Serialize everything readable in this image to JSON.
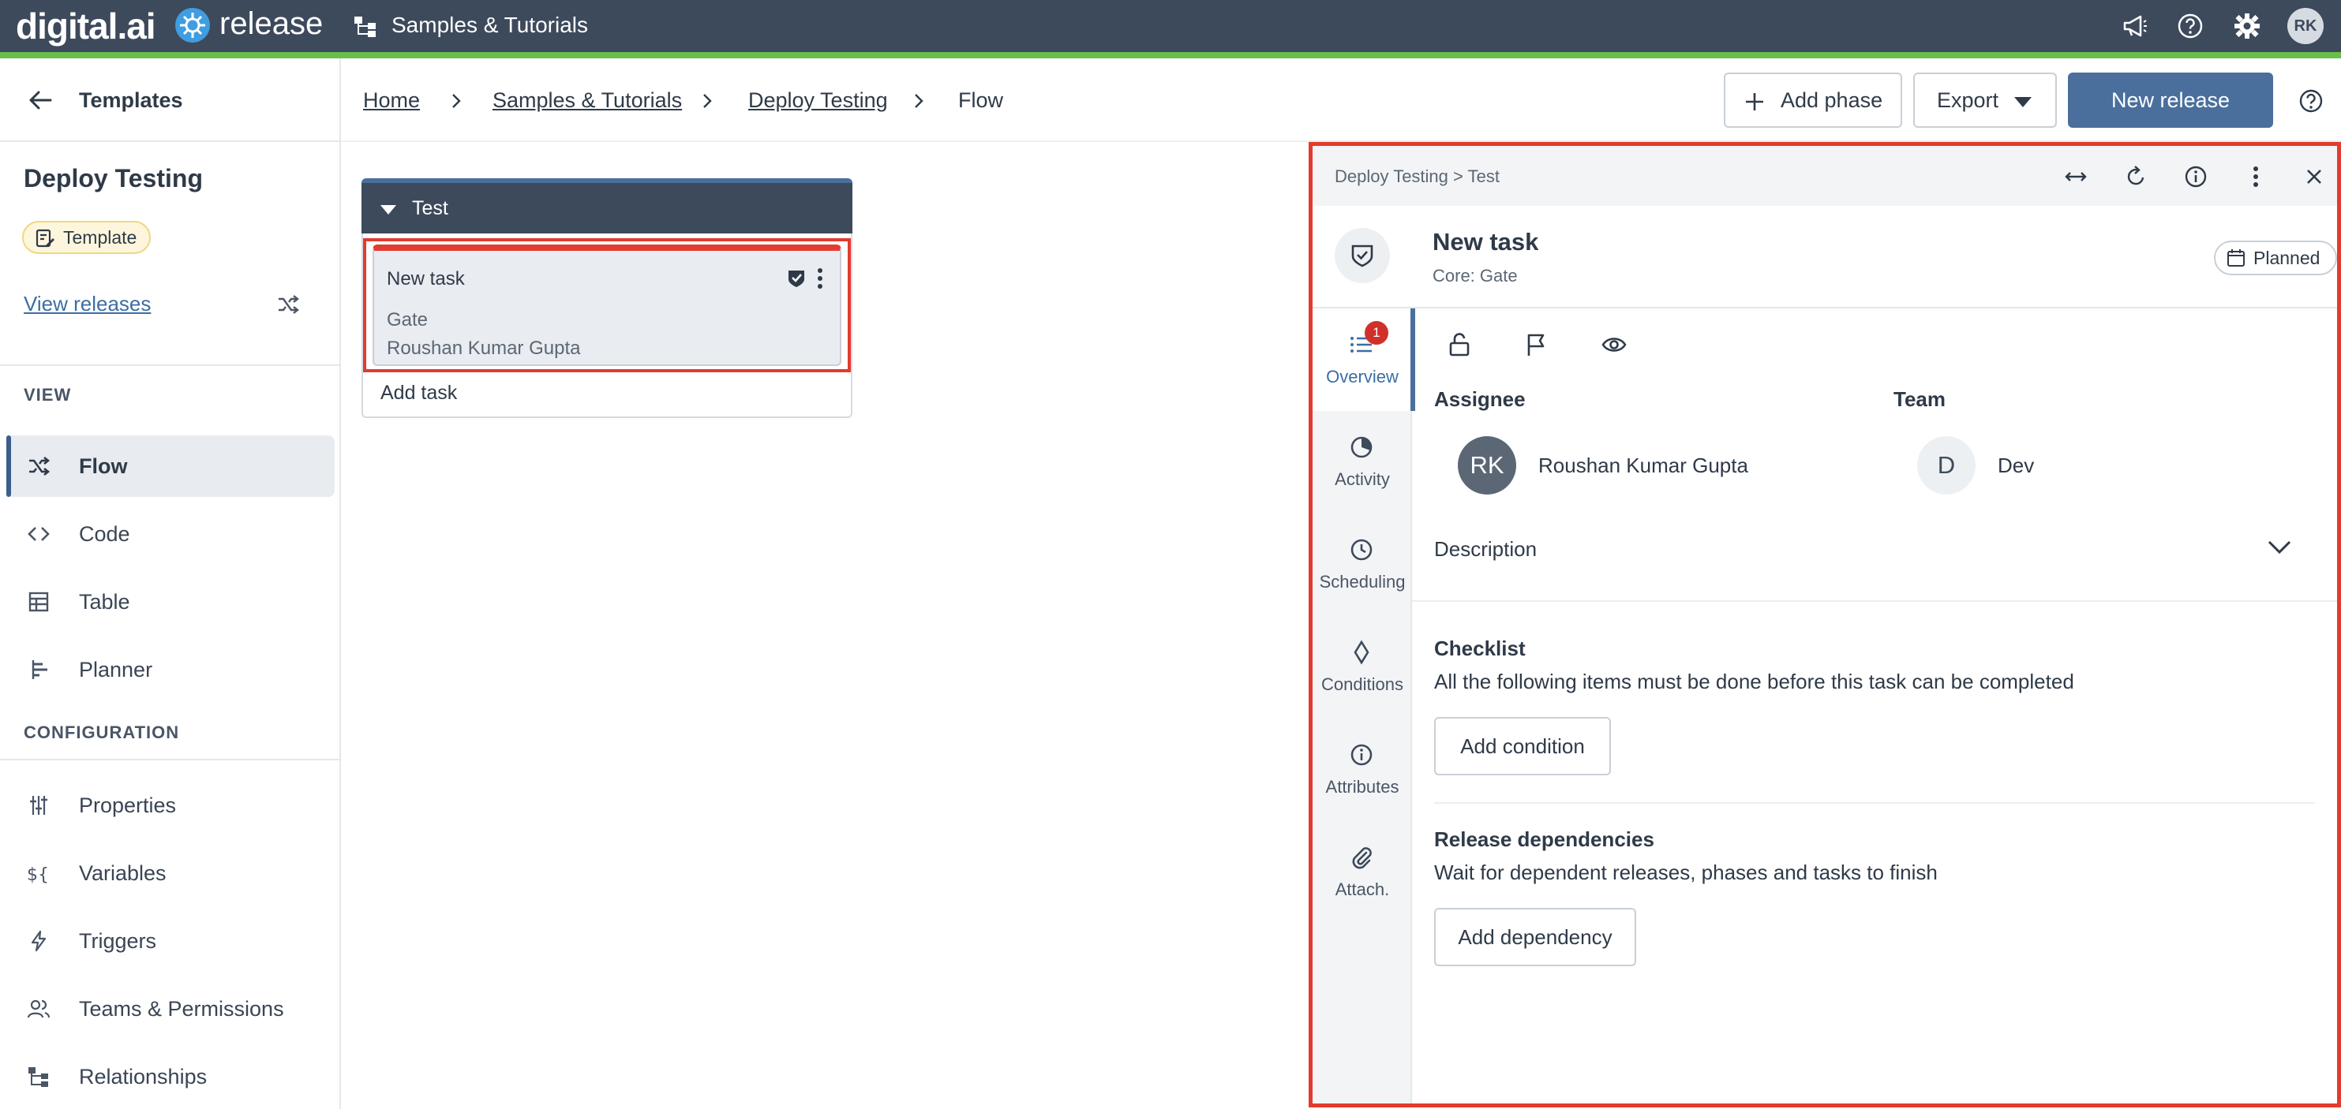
{
  "topbar": {
    "brand": "digital.ai",
    "product": "release",
    "folder_title": "Samples & Tutorials",
    "user_initials": "RK"
  },
  "sidebar": {
    "back_label": "Templates",
    "project_name": "Deploy Testing",
    "badge": "Template",
    "view_releases": "View releases",
    "view_section": "VIEW",
    "view_items": [
      {
        "label": "Flow",
        "icon": "flow-icon",
        "active": true
      },
      {
        "label": "Code",
        "icon": "code-icon"
      },
      {
        "label": "Table",
        "icon": "table-icon"
      },
      {
        "label": "Planner",
        "icon": "planner-icon"
      }
    ],
    "config_section": "CONFIGURATION",
    "config_items": [
      {
        "label": "Properties",
        "icon": "sliders-icon"
      },
      {
        "label": "Variables",
        "icon": "variables-icon"
      },
      {
        "label": "Triggers",
        "icon": "lightning-icon"
      },
      {
        "label": "Teams & Permissions",
        "icon": "users-icon"
      },
      {
        "label": "Relationships",
        "icon": "hierarchy-icon"
      }
    ]
  },
  "header": {
    "breadcrumbs": [
      "Home",
      "Samples & Tutorials",
      "Deploy Testing",
      "Flow"
    ],
    "add_phase": "Add phase",
    "export": "Export",
    "new_release": "New release"
  },
  "canvas": {
    "phase_name": "Test",
    "task": {
      "title": "New task",
      "type": "Gate",
      "owner": "Roushan Kumar Gupta"
    },
    "add_task": "Add task"
  },
  "panel": {
    "breadcrumb": "Deploy Testing  >  Test",
    "title": "New task",
    "subtitle": "Core: Gate",
    "status": "Planned",
    "tabs": [
      {
        "label": "Overview",
        "icon": "list-icon",
        "badge": "1",
        "active": true
      },
      {
        "label": "Activity",
        "icon": "activity-icon"
      },
      {
        "label": "Scheduling",
        "icon": "clock-icon"
      },
      {
        "label": "Conditions",
        "icon": "diamond-icon"
      },
      {
        "label": "Attributes",
        "icon": "info-icon"
      },
      {
        "label": "Attach.",
        "icon": "paperclip-icon"
      }
    ],
    "assignee_label": "Assignee",
    "assignee_initials": "RK",
    "assignee_name": "Roushan Kumar Gupta",
    "team_label": "Team",
    "team_initial": "D",
    "team_name": "Dev",
    "description_label": "Description",
    "checklist_title": "Checklist",
    "checklist_text": "All the following items must be done before this task can be completed",
    "add_condition": "Add condition",
    "dependencies_title": "Release dependencies",
    "dependencies_text": "Wait for dependent releases, phases and tasks to finish",
    "add_dependency": "Add dependency"
  }
}
